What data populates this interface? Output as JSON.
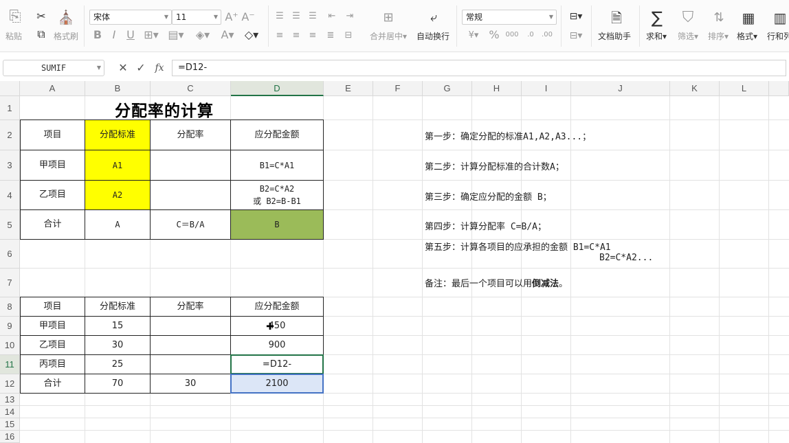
{
  "ribbon": {
    "paste": "粘贴",
    "format_painter": "格式刷",
    "font_name": "宋体",
    "font_size": "11",
    "merge_center": "合并居中",
    "wrap_text": "自动换行",
    "number_format": "常规",
    "doc_assistant": "文档助手",
    "sum": "求和",
    "filter": "筛选",
    "sort": "排序",
    "format": "格式",
    "rows_cols": "行和列"
  },
  "formula_bar": {
    "name_box": "SUMIF",
    "fx": "fx",
    "formula": "=D12-"
  },
  "columns": [
    "A",
    "B",
    "C",
    "D",
    "E",
    "F",
    "G",
    "H",
    "I",
    "J",
    "K",
    "L"
  ],
  "rows": [
    "1",
    "2",
    "3",
    "4",
    "5",
    "6",
    "7",
    "8",
    "9",
    "10",
    "11",
    "12",
    "13",
    "14",
    "15",
    "16"
  ],
  "table1": {
    "title": "分配率的计算",
    "headers": [
      "项目",
      "分配标准",
      "分配率",
      "应分配金额"
    ],
    "rows": [
      [
        "甲项目",
        "A1",
        "",
        "B1=C*A1"
      ],
      [
        "乙项目",
        "A2",
        "",
        "B2=C*A2"
      ],
      [
        "合计",
        "A",
        "C＝B/A",
        "B"
      ]
    ],
    "d4_second_line": "或 B2=B-B1"
  },
  "steps": {
    "step1": "第一步：确定分配的标准A1,A2,A3...；",
    "step2": "第二步：计算分配标准的合计数A；",
    "step3": "第三步：确定应分配的金额 B；",
    "step4": "第四步：计算分配率 C=B/A；",
    "step5": "第五步：计算各项目的应承担的金额  B1=C*A1",
    "step5_line2": "B2=C*A2...",
    "note_prefix": "备注：最后一个项目可以用",
    "note_bold": "倒减法",
    "note_suffix": "。"
  },
  "table2": {
    "headers": [
      "项目",
      "分配标准",
      "分配率",
      "应分配金额"
    ],
    "rows": [
      [
        "甲项目",
        "15",
        "",
        "450"
      ],
      [
        "乙项目",
        "30",
        "",
        "900"
      ],
      [
        "丙项目",
        "25",
        "",
        "=D12-"
      ],
      [
        "合计",
        "70",
        "30",
        "2100"
      ]
    ]
  },
  "colors": {
    "highlight_yellow": "#ffff00",
    "highlight_olive": "#9bbb59",
    "selection_green": "#217346",
    "ref_blue": "#dce6f7"
  }
}
